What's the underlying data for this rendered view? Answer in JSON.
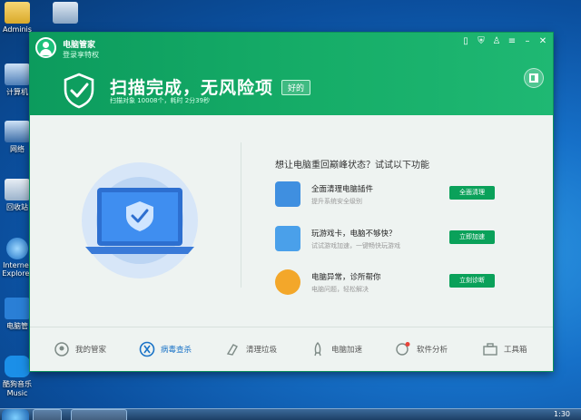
{
  "desktop": {
    "icons": [
      {
        "label": "Adminis"
      },
      {
        "label": "计算机"
      },
      {
        "label": "网络"
      },
      {
        "label": "回收站"
      },
      {
        "label": "Internet Explorer"
      },
      {
        "label": "电脑管"
      },
      {
        "label": "酷狗音乐 Music"
      }
    ],
    "clock": "1:30"
  },
  "app": {
    "name": "电脑管家",
    "login_text": "登录享特权"
  },
  "status": {
    "title": "扫描完成，无风险项",
    "badge": "好的",
    "subline": "扫描对象 10008个，耗时 2分39秒"
  },
  "suggestion": {
    "question": "想让电脑重回巅峰状态？试试以下功能",
    "items": [
      {
        "title": "全面清理电脑插件",
        "sub": "提升系统安全级别",
        "button": "全面清理",
        "icon": "puzzle-icon"
      },
      {
        "title": "玩游戏卡，电脑不够快？",
        "sub": "试试游戏加速，一键畅快玩游戏",
        "button": "立即加速",
        "icon": "rocket-icon"
      },
      {
        "title": "电脑异常，诊所帮你",
        "sub": "电脑问题，轻松解决",
        "button": "立刻诊断",
        "icon": "stethoscope-icon"
      }
    ]
  },
  "bottom_nav": [
    {
      "label": "我的管家",
      "icon": "butler-icon",
      "active": false
    },
    {
      "label": "病毒查杀",
      "icon": "virus-scan-icon",
      "active": true
    },
    {
      "label": "清理垃圾",
      "icon": "broom-icon",
      "active": false
    },
    {
      "label": "电脑加速",
      "icon": "rocket-icon",
      "active": false
    },
    {
      "label": "软件分析",
      "icon": "analysis-icon",
      "active": false
    },
    {
      "label": "工具箱",
      "icon": "toolbox-icon",
      "active": false
    }
  ],
  "colors": {
    "header_green": "#0c9b5d",
    "button_green": "#0aa15a",
    "active_blue": "#1a73c7"
  }
}
